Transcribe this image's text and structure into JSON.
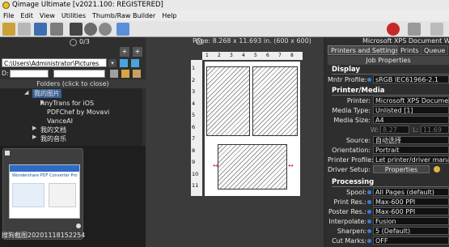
{
  "window": {
    "title": "Qimage Ultimate [v2021.100: REGISTERED]"
  },
  "menu": [
    "File",
    "Edit",
    "View",
    "Utilities",
    "Thumb/Raw Builder",
    "Help"
  ],
  "left": {
    "count": "0/3",
    "path": "C:\\Users\\Administrator\\Pictures",
    "drive_label": "D:",
    "folders_header": "Folders (click to close)",
    "tree": [
      "我的图片",
      "AnyTrans for iOS",
      "PDFChef by Movavi",
      "VanceAI",
      "我的文档",
      "我的音乐"
    ],
    "thumb_caption": "搜狗截图20201118152254.p...",
    "shot_title": "Wondershare PDF Converter Pro"
  },
  "center": {
    "page_info": "Page: 8.268 x 11.693 in.  (600 x 600)",
    "top_ruler": [
      "1",
      "2",
      "3",
      "4",
      "5",
      "6",
      "7",
      "8"
    ],
    "left_ruler": [
      "1",
      "2",
      "3",
      "4",
      "5",
      "6",
      "7",
      "8",
      "9",
      "10",
      "11"
    ]
  },
  "right": {
    "printer_name": "Microsoft XPS Document Writer",
    "tabs": [
      "Printers and Settings*",
      "Prints",
      "Queue"
    ],
    "job_properties": "Job Properties",
    "sections": {
      "display": "Display",
      "printer_media": "Printer/Media",
      "processing": "Processing"
    },
    "display": {
      "mntr_profile_label": "Mntr Profile:",
      "mntr_profile_value": "sRGB IEC61966-2.1"
    },
    "printer": {
      "printer_label": "Printer:",
      "printer_value": "Microsoft XPS Document Writer",
      "media_type_label": "Media Type:",
      "media_type_value": "Unlisted [1]",
      "media_size_label": "Media Size:",
      "media_size_value": "A4",
      "w_label": "W:",
      "w_value": "8.27",
      "l_label": "L:",
      "l_value": "11.69",
      "source_label": "Source:",
      "source_value": "自动选择",
      "orientation_label": "Orientation:",
      "orientation_value": "Portrait",
      "profile_label": "Printer Profile:",
      "profile_value": "Let printer/driver manage color",
      "driver_label": "Driver Setup:",
      "driver_value": "Properties"
    },
    "processing": {
      "spool_label": "Spool:",
      "spool_value": "All Pages (default)",
      "print_res_label": "Print Res.:",
      "print_res_value": "Max-600 PPI",
      "poster_res_label": "Poster Res.:",
      "poster_res_value": "Max-600 PPI",
      "interpolate_label": "Interpolate:",
      "interpolate_value": "Fusion",
      "sharpen_label": "Sharpen:",
      "sharpen_value": "5 (Default)",
      "cut_marks_label": "Cut Marks:",
      "cut_marks_value": "OFF"
    }
  },
  "colors": {
    "accent": "#3a7bd5",
    "dark_panel": "#2e2e2e"
  }
}
